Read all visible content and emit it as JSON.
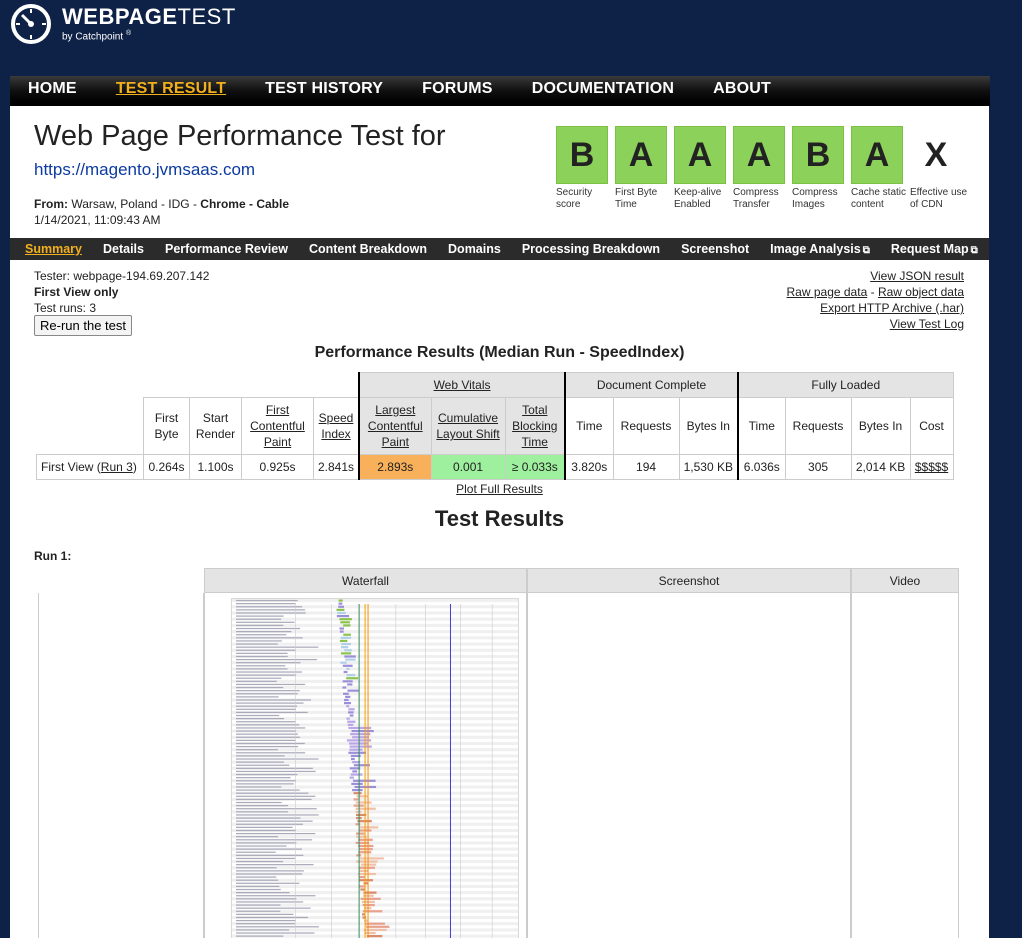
{
  "logo": {
    "title_bold": "WEBPAGE",
    "title_light": "TEST",
    "subtitle": "by Catchpoint",
    "reg": "®"
  },
  "topnav": [
    "HOME",
    "TEST RESULT",
    "TEST HISTORY",
    "FORUMS",
    "DOCUMENTATION",
    "ABOUT"
  ],
  "heading": {
    "title": "Web Page Performance Test for",
    "url": "https://magento.jvmsaas.com",
    "from_label": "From:",
    "from_location": "Warsaw, Poland - IDG -",
    "browser": "Chrome",
    "sep": "-",
    "connection": "Cable",
    "date": "1/14/2021, 11:09:43 AM"
  },
  "grades": [
    {
      "grade": "B",
      "label": "Security score"
    },
    {
      "grade": "A",
      "label": "First Byte Time"
    },
    {
      "grade": "A",
      "label": "Keep-alive Enabled"
    },
    {
      "grade": "A",
      "label": "Compress Transfer"
    },
    {
      "grade": "B",
      "label": "Compress Images"
    },
    {
      "grade": "A",
      "label": "Cache static content"
    },
    {
      "grade": "X",
      "label": "Effective use of CDN"
    }
  ],
  "colors": {
    "grade_green": "#8cd15a",
    "nav_active": "#f2b01e",
    "lcp": "#f8b05a",
    "cls": "#9ef09e",
    "background": "#0e2146"
  },
  "subnav": [
    "Summary",
    "Details",
    "Performance Review",
    "Content Breakdown",
    "Domains",
    "Processing Breakdown",
    "Screenshot",
    "Image Analysis",
    "Request Map"
  ],
  "tester": {
    "tester": "Tester: webpage-194.69.207.142",
    "view": "First View only",
    "runs": "Test runs: 3",
    "rerun": "Re-run the test"
  },
  "links": {
    "json": "View JSON result",
    "raw_page": "Raw page data",
    "dash": "-",
    "raw_object": "Raw object data",
    "har": "Export HTTP Archive (.har)",
    "log": "View Test Log"
  },
  "perf": {
    "title": "Performance Results (Median Run - SpeedIndex)",
    "groups": {
      "web_vitals": "Web Vitals",
      "doc_complete": "Document Complete",
      "fully_loaded": "Fully Loaded"
    },
    "headers": {
      "first_byte": "First Byte",
      "start_render": "Start Render",
      "fcp": "First Contentful Paint",
      "speed_index": "Speed Index",
      "lcp": "Largest Contentful Paint",
      "cls": "Cumulative Layout Shift",
      "tbt": "Total Blocking Time",
      "time": "Time",
      "requests": "Requests",
      "bytes_in": "Bytes In",
      "cost": "Cost"
    },
    "row": {
      "label": "First View (",
      "run_link": "Run 3",
      "label_end": ")",
      "first_byte": "0.264s",
      "start_render": "1.100s",
      "fcp": "0.925s",
      "speed_index": "2.841s",
      "lcp": "2.893s",
      "cls": "0.001",
      "tbt": "≥ 0.033s",
      "doc_time": "3.820s",
      "doc_requests": "194",
      "doc_bytes": "1,530 KB",
      "full_time": "6.036s",
      "full_requests": "305",
      "full_bytes": "2,014 KB",
      "cost": "$$$$$"
    },
    "plot_full": "Plot Full Results"
  },
  "test_results": {
    "title": "Test Results",
    "run": "Run 1:",
    "columns": [
      "Waterfall",
      "Screenshot",
      "Video"
    ],
    "waterfall_rows": 112
  }
}
